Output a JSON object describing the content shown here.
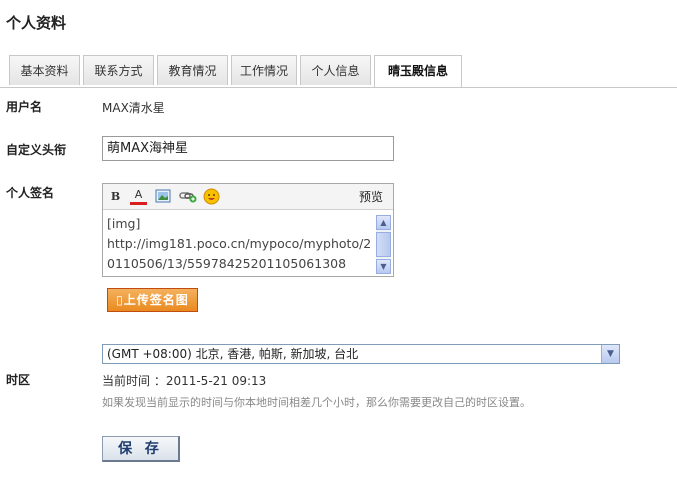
{
  "page": {
    "title": "个人资料"
  },
  "tabs": [
    {
      "label": "基本资料",
      "active": false
    },
    {
      "label": "联系方式",
      "active": false
    },
    {
      "label": "教育情况",
      "active": false
    },
    {
      "label": "工作情况",
      "active": false
    },
    {
      "label": "个人信息",
      "active": false
    },
    {
      "label": "晴玉殿信息",
      "active": true
    }
  ],
  "form": {
    "username": {
      "label": "用户名",
      "value": "MAX清水星"
    },
    "custom_title": {
      "label": "自定义头衔",
      "value": "萌MAX海神星"
    },
    "signature": {
      "label": "个人签名",
      "content": "[img]\nhttp://img181.poco.cn/mypoco/myphoto/20110506/13/55978425201105061308",
      "toolbar": {
        "bold": "B",
        "font_color": "A",
        "icons": [
          "bold-icon",
          "font-color-icon",
          "image-icon",
          "link-icon",
          "emoticon-icon"
        ],
        "preview_label": "预览"
      },
      "upload_label": "上传签名图"
    },
    "timezone": {
      "label": "时区",
      "selected": "(GMT +08:00) 北京, 香港, 帕斯, 新加坡, 台北",
      "current_time": "当前时间 ：2011-5-21 09:13",
      "hint": "如果发现当前显示的时间与你本地时间相差几个小时，那么你需要更改自己的时区设置。"
    },
    "save_label": "保 存"
  },
  "colors": {
    "upload_button": "#ea8a1f",
    "save_text": "#1e3c6e",
    "tab_border": "#c8c8c8"
  }
}
